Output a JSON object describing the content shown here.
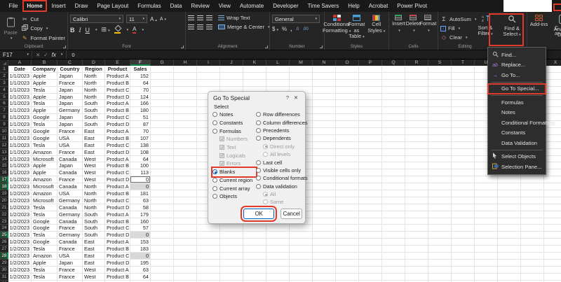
{
  "tabs": {
    "items": [
      {
        "label": "File"
      },
      {
        "label": "Home",
        "active": true
      },
      {
        "label": "Insert"
      },
      {
        "label": "Draw"
      },
      {
        "label": "Page Layout"
      },
      {
        "label": "Formulas"
      },
      {
        "label": "Data"
      },
      {
        "label": "Review"
      },
      {
        "label": "View"
      },
      {
        "label": "Automate"
      },
      {
        "label": "Developer"
      },
      {
        "label": "Time Savers"
      },
      {
        "label": "Help"
      },
      {
        "label": "Acrobat"
      },
      {
        "label": "Power Pivot"
      }
    ]
  },
  "ribbon": {
    "clipboard": {
      "label": "Clipboard",
      "paste": "Paste",
      "cut": "Cut",
      "copy": "Copy",
      "format_painter": "Format Painter"
    },
    "font": {
      "label": "Font",
      "family": "Calibri",
      "size": "11",
      "bold": "B",
      "italic": "I",
      "underline": "U"
    },
    "alignment": {
      "label": "Alignment",
      "wrap": "Wrap Text",
      "merge": "Merge & Center"
    },
    "number": {
      "label": "Number",
      "format": "General",
      "currency": "$",
      "percent": "%",
      "comma": ",",
      "inc": ".0",
      "dec": ".00"
    },
    "styles": {
      "label": "Styles",
      "conditional": "Conditional Formatting",
      "format_table": "Format as Table",
      "cell_styles": "Cell Styles"
    },
    "cells": {
      "label": "Cells",
      "insert": "Insert",
      "delete": "Delete",
      "format": "Format"
    },
    "editing": {
      "label": "Editing",
      "autosum": "AutoSum",
      "fill": "Fill",
      "clear": "Clear",
      "sort": "Sort & Filter",
      "find": "Find & Select"
    },
    "addins": {
      "label": "Add-ins"
    },
    "analyze": {
      "label": "Analyze Data"
    },
    "partial": {
      "line1": "C",
      "line2": "an"
    }
  },
  "formula_bar": {
    "name_box": "F17",
    "cancel": "✕",
    "enter": "✓",
    "fx": "fx",
    "value": "0"
  },
  "grid": {
    "columns": [
      "A",
      "B",
      "C",
      "D",
      "E",
      "F",
      "G",
      "H",
      "I",
      "J",
      "K",
      "L",
      "M",
      "N",
      "O",
      "P",
      "Q",
      "R",
      "S",
      "T",
      "U",
      "V",
      "W",
      "X"
    ],
    "selected_column": "F",
    "headers": [
      "Date",
      "Company",
      "Country",
      "Region",
      "Product",
      "Sales"
    ],
    "active_row": 17,
    "selected_rows": [
      18,
      25,
      28
    ],
    "rows": [
      [
        "1/1/2023",
        "Apple",
        "Japan",
        "North",
        "Product A",
        "152"
      ],
      [
        "1/1/2023",
        "Apple",
        "France",
        "North",
        "Product B",
        "64"
      ],
      [
        "1/1/2023",
        "Tesla",
        "Japan",
        "North",
        "Product C",
        "70"
      ],
      [
        "1/1/2023",
        "Apple",
        "Japan",
        "North",
        "Product D",
        "124"
      ],
      [
        "1/1/2023",
        "Tesla",
        "Japan",
        "South",
        "Product A",
        "166"
      ],
      [
        "1/1/2023",
        "Apple",
        "Germany",
        "South",
        "Product B",
        "180"
      ],
      [
        "1/1/2023",
        "Google",
        "Japan",
        "South",
        "Product C",
        "51"
      ],
      [
        "1/1/2023",
        "Tesla",
        "Japan",
        "South",
        "Product D",
        "87"
      ],
      [
        "1/1/2023",
        "Google",
        "France",
        "East",
        "Product A",
        "70"
      ],
      [
        "1/1/2023",
        "Google",
        "USA",
        "East",
        "Product B",
        "107"
      ],
      [
        "1/1/2023",
        "Tesla",
        "USA",
        "East",
        "Product C",
        "138"
      ],
      [
        "1/1/2023",
        "Amazon",
        "France",
        "East",
        "Product D",
        "108"
      ],
      [
        "1/1/2023",
        "Microsoft",
        "Canada",
        "West",
        "Product A",
        "64"
      ],
      [
        "1/1/2023",
        "Apple",
        "Japan",
        "West",
        "Product B",
        "100"
      ],
      [
        "1/1/2023",
        "Apple",
        "Canada",
        "West",
        "Product C",
        "113"
      ],
      [
        "1/1/2023",
        "Amazon",
        "France",
        "West",
        "Product D",
        "0"
      ],
      [
        "1/2/2023",
        "Microsoft",
        "Canada",
        "North",
        "Product A",
        "0"
      ],
      [
        "1/2/2023",
        "Amazon",
        "USA",
        "North",
        "Product B",
        "181"
      ],
      [
        "1/2/2023",
        "Microsoft",
        "Germany",
        "North",
        "Product C",
        "63"
      ],
      [
        "1/2/2023",
        "Tesla",
        "Canada",
        "North",
        "Product D",
        "58"
      ],
      [
        "1/2/2023",
        "Tesla",
        "Germany",
        "South",
        "Product A",
        "179"
      ],
      [
        "1/2/2023",
        "Google",
        "Canada",
        "South",
        "Product B",
        "160"
      ],
      [
        "1/2/2023",
        "Google",
        "France",
        "South",
        "Product C",
        "57"
      ],
      [
        "1/2/2023",
        "Tesla",
        "Germany",
        "South",
        "Product D",
        "0"
      ],
      [
        "1/2/2023",
        "Google",
        "Canada",
        "East",
        "Product A",
        "153"
      ],
      [
        "1/2/2023",
        "Tesla",
        "France",
        "East",
        "Product B",
        "183"
      ],
      [
        "1/2/2023",
        "Amazon",
        "USA",
        "East",
        "Product C",
        "0"
      ],
      [
        "1/2/2023",
        "Apple",
        "Japan",
        "East",
        "Product D",
        "195"
      ],
      [
        "1/2/2023",
        "Tesla",
        "France",
        "West",
        "Product A",
        "63"
      ],
      [
        "1/2/2023",
        "Tesla",
        "France",
        "West",
        "Product B",
        "64"
      ]
    ]
  },
  "menu": {
    "items": [
      {
        "label": "Find...",
        "icon": "search"
      },
      {
        "label": "Replace...",
        "icon": "replace"
      },
      {
        "label": "Go To...",
        "icon": "goto"
      },
      {
        "type": "separator"
      },
      {
        "label": "Go To Special...",
        "highlight": true
      },
      {
        "type": "separator"
      },
      {
        "label": "Formulas"
      },
      {
        "label": "Notes"
      },
      {
        "label": "Conditional Formatting"
      },
      {
        "label": "Constants"
      },
      {
        "label": "Data Validation"
      },
      {
        "type": "separator"
      },
      {
        "label": "Select Objects",
        "icon": "cursor"
      },
      {
        "label": "Selection Pane...",
        "icon": "pane"
      }
    ]
  },
  "dialog": {
    "title": "Go To Special",
    "help": "?",
    "close": "✕",
    "select_label": "Select",
    "left": [
      {
        "label": "Notes",
        "type": "radio"
      },
      {
        "label": "Constants",
        "type": "radio"
      },
      {
        "label": "Formulas",
        "type": "radio"
      },
      {
        "label": "Numbers",
        "type": "checkbox",
        "checked": true,
        "disabled": true,
        "indent": true
      },
      {
        "label": "Text",
        "type": "checkbox",
        "checked": true,
        "disabled": true,
        "indent": true
      },
      {
        "label": "Logicals",
        "type": "checkbox",
        "checked": true,
        "disabled": true,
        "indent": true
      },
      {
        "label": "Errors",
        "type": "checkbox",
        "checked": true,
        "disabled": true,
        "indent": true
      },
      {
        "label": "Blanks",
        "type": "radio",
        "selected": true,
        "highlight": true
      },
      {
        "label": "Current region",
        "type": "radio"
      },
      {
        "label": "Current array",
        "type": "radio"
      },
      {
        "label": "Objects",
        "type": "radio"
      }
    ],
    "right": [
      {
        "label": "Row differences",
        "type": "radio"
      },
      {
        "label": "Column differences",
        "type": "radio"
      },
      {
        "label": "Precedents",
        "type": "radio"
      },
      {
        "label": "Dependents",
        "type": "radio"
      },
      {
        "label": "Direct only",
        "type": "radio",
        "selected": true,
        "disabled": true,
        "indent": true
      },
      {
        "label": "All levels",
        "type": "radio",
        "disabled": true,
        "indent": true
      },
      {
        "label": "Last cell",
        "type": "radio"
      },
      {
        "label": "Visible cells only",
        "type": "radio"
      },
      {
        "label": "Conditional formats",
        "type": "radio"
      },
      {
        "label": "Data validation",
        "type": "radio"
      },
      {
        "label": "All",
        "type": "radio",
        "selected": true,
        "disabled": true,
        "indent": true
      },
      {
        "label": "Same",
        "type": "radio",
        "disabled": true,
        "indent": true
      }
    ],
    "ok": "OK",
    "cancel": "Cancel"
  }
}
